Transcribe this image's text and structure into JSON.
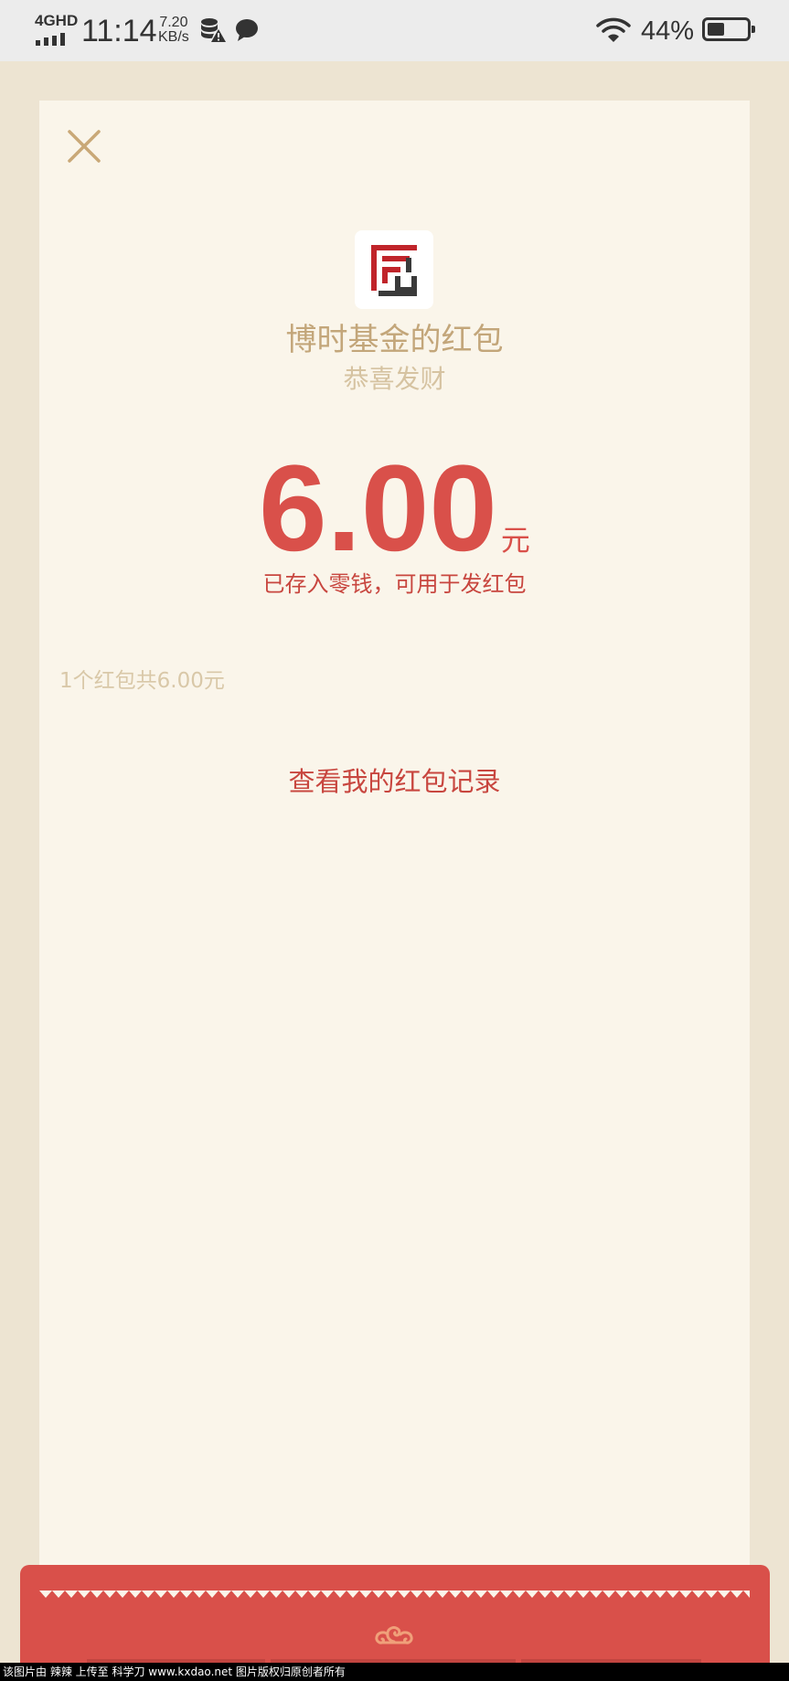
{
  "status_bar": {
    "network_label": "4GHD",
    "time": "11:14",
    "speed_value": "7.20",
    "speed_unit": "KB/s",
    "battery_percent_text": "44%",
    "battery_level": 0.44,
    "icons": [
      "signal-icon",
      "database-alert-icon",
      "chat-icon",
      "wifi-icon",
      "battery-icon"
    ]
  },
  "envelope": {
    "close_icon": "close-icon",
    "logo_icon": "fund-logo-icon",
    "sender": "博时基金的红包",
    "blessing": "恭喜发财",
    "amount": "6.00",
    "unit": "元",
    "note": "已存入零钱，可用于发红包",
    "summary": "1个红包共6.00元",
    "history_link": "查看我的红包记录"
  },
  "bottom": {
    "cloud_icon": "auspicious-cloud-icon"
  },
  "watermark": "该图片由 辣辣 上传至 科学刀 www.kxdao.net 图片版权归原创者所有",
  "colors": {
    "page_background": "#ede4d2",
    "card_background": "#faf5ea",
    "accent_red": "#d9504a",
    "gold": "#c3a67a",
    "light_gold": "#d6c3a1"
  }
}
